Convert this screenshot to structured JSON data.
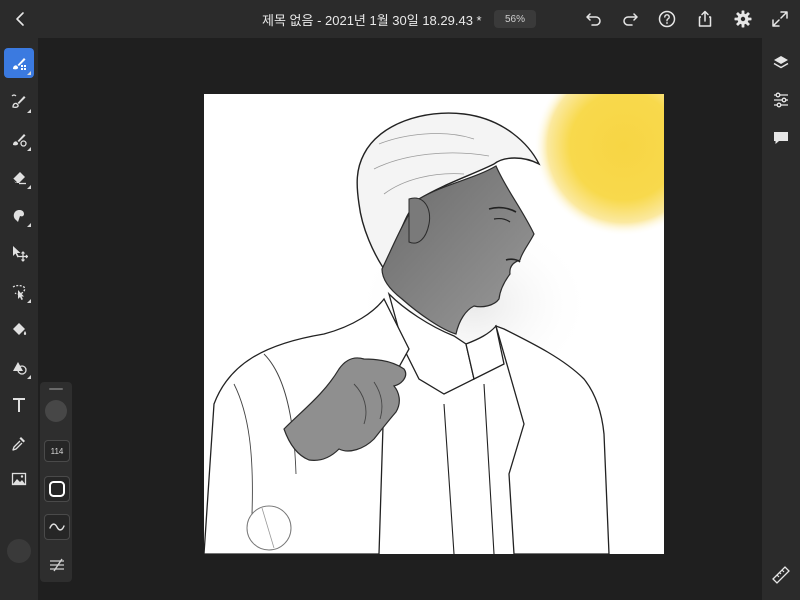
{
  "header": {
    "title": "제목 없음 - 2021년 1월 30일 18.29.43 *",
    "zoom": "56%",
    "icons": [
      "chevron-left-icon",
      "chevron-down-icon",
      "undo-icon",
      "redo-icon",
      "help-icon",
      "share-icon",
      "gear-icon",
      "fullscreen-icon"
    ]
  },
  "left_toolbar": {
    "tools": [
      "pixel-brush-icon",
      "live-brush-icon",
      "vector-brush-icon",
      "eraser-icon",
      "smudge-icon",
      "transform-icon",
      "selection-icon",
      "fill-icon",
      "shape-icon",
      "text-icon",
      "eyedropper-icon",
      "image-icon"
    ],
    "active_tool": "pixel-brush-icon",
    "color": "#3a3a3a"
  },
  "brush_panel": {
    "size": "114"
  },
  "right_toolbar": {
    "icons": [
      "layers-icon",
      "properties-icon",
      "comment-icon",
      "ruler-icon"
    ]
  },
  "colors": {
    "accent": "#3b7ae0",
    "chrome": "#2b2b2b",
    "workspace": "#1f1f1f",
    "sun": "#f7d544"
  }
}
